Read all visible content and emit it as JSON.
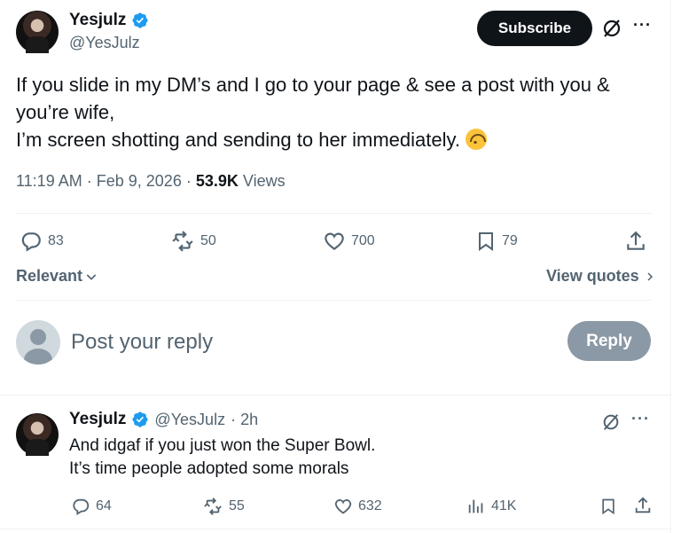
{
  "tweet": {
    "author_name": "Yesjulz",
    "author_handle": "@YesJulz",
    "subscribe_label": "Subscribe",
    "text_lines": [
      "If you slide in my DM’s and I go to your page & see a post with you &",
      "you’re wife,",
      "I’m screen shotting and sending to her immediately."
    ],
    "emoji": "upside-down-face",
    "time": "11:19 AM",
    "date": "Feb 9, 2026",
    "views_count": "53.9K",
    "views_label": "Views",
    "meta_sep": "·",
    "actions": {
      "replies": "83",
      "reposts": "50",
      "likes": "700",
      "bookmarks": "79"
    }
  },
  "replies_sort": {
    "label": "Relevant",
    "view_quotes_label": "View quotes"
  },
  "composer": {
    "placeholder": "Post your reply",
    "button_label": "Reply"
  },
  "reply_tweet": {
    "author_name": "Yesjulz",
    "author_handle": "@YesJulz",
    "time_ago": "· 2h",
    "text_lines": [
      "And idgaf if you just won the Super Bowl.",
      "It’s time people adopted some morals"
    ],
    "actions": {
      "replies": "64",
      "reposts": "55",
      "likes": "632",
      "views": "41K"
    }
  },
  "colors": {
    "text": "#0f1419",
    "muted": "#536471",
    "verified": "#1d9bf0",
    "reply_button": "#8b98a5",
    "subscribe": "#0f1419"
  },
  "icons": [
    "verified-badge-icon",
    "grok-icon",
    "more-icon",
    "reply-icon",
    "repost-icon",
    "like-icon",
    "bookmark-icon",
    "share-icon",
    "chevron-down-icon",
    "chevron-right-icon",
    "views-icon"
  ]
}
